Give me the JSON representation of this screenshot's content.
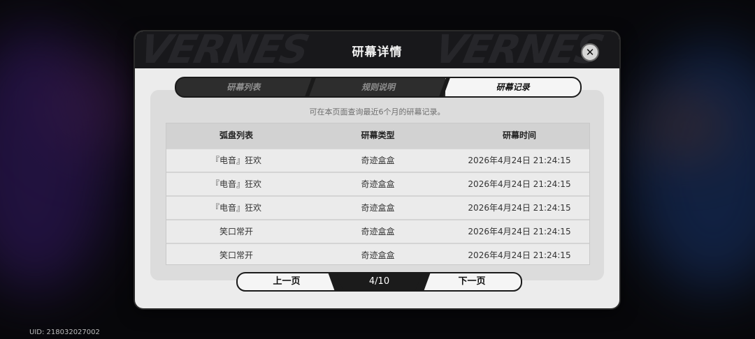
{
  "modal": {
    "title": "研幕详情",
    "close_icon": "close-icon",
    "header_decoration": "VERNES"
  },
  "tabs": [
    {
      "label": "研幕列表",
      "active": false
    },
    {
      "label": "规则说明",
      "active": false
    },
    {
      "label": "研幕记录",
      "active": true
    }
  ],
  "record": {
    "note": "可在本页面查询最近6个月的研幕记录。",
    "columns": [
      "弧盘列表",
      "研幕类型",
      "研幕时间"
    ],
    "rows": [
      [
        "『电音』狂欢",
        "奇迹盒盒",
        "2026年4月24日 21:24:15"
      ],
      [
        "『电音』狂欢",
        "奇迹盒盒",
        "2026年4月24日 21:24:15"
      ],
      [
        "『电音』狂欢",
        "奇迹盒盒",
        "2026年4月24日 21:24:15"
      ],
      [
        "笑口常开",
        "奇迹盒盒",
        "2026年4月24日 21:24:15"
      ],
      [
        "笑口常开",
        "奇迹盒盒",
        "2026年4月24日 21:24:15"
      ]
    ]
  },
  "pager": {
    "prev_label": "上一页",
    "page_indicator": "4/10",
    "next_label": "下一页"
  },
  "uid": "UID: 218032027002"
}
